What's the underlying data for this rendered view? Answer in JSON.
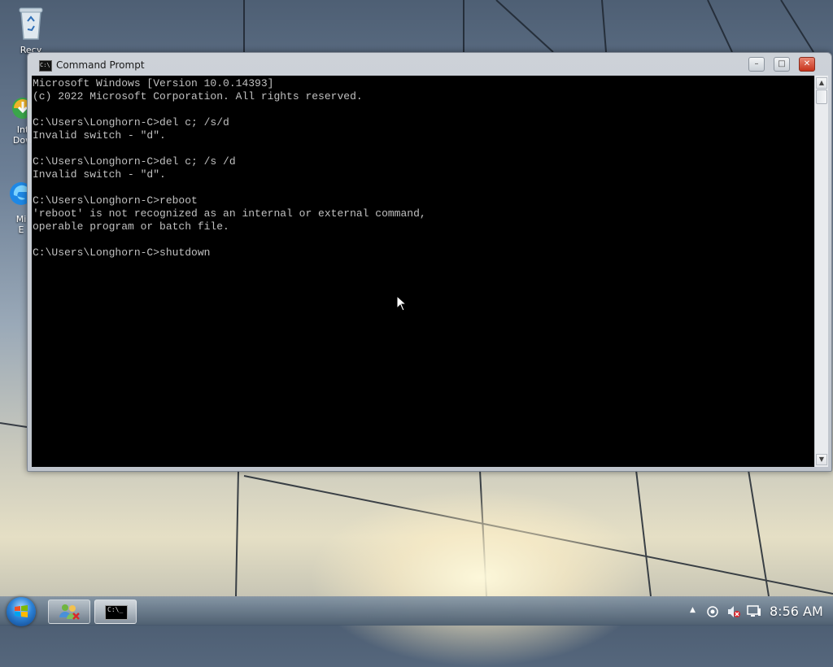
{
  "desktop": {
    "icons": [
      {
        "label": "Recy",
        "icon": "recycle-bin-icon"
      },
      {
        "label": "Int\nDow",
        "icon": "internet-download-icon"
      },
      {
        "label": "Mi\nE",
        "icon": "edge-browser-icon"
      }
    ]
  },
  "window": {
    "title": "Command Prompt",
    "icon": "cmd-icon",
    "console_text": "Microsoft Windows [Version 10.0.14393]\n(c) 2022 Microsoft Corporation. All rights reserved.\n\nC:\\Users\\Longhorn-C>del c; /s/d\nInvalid switch - \"d\".\n\nC:\\Users\\Longhorn-C>del c; /s /d\nInvalid switch - \"d\".\n\nC:\\Users\\Longhorn-C>reboot\n'reboot' is not recognized as an internal or external command,\noperable program or batch file.\n\nC:\\Users\\Longhorn-C>shutdown",
    "buttons": {
      "minimize": "–",
      "maximize": "□",
      "close": "✕"
    }
  },
  "taskbar": {
    "start_icon": "windows-start-orb-icon",
    "pinned": [
      {
        "name": "users-network-app",
        "icon": "users-network-icon"
      },
      {
        "name": "command-prompt",
        "icon": "cmd-icon",
        "glyph": "C:\\_"
      }
    ],
    "tray": {
      "show_hidden_glyph": "▲",
      "clock": "8:56 AM"
    }
  },
  "colors": {
    "console_bg": "#000000",
    "console_fg": "#c0c0c0",
    "close_button": "#c7331c"
  }
}
